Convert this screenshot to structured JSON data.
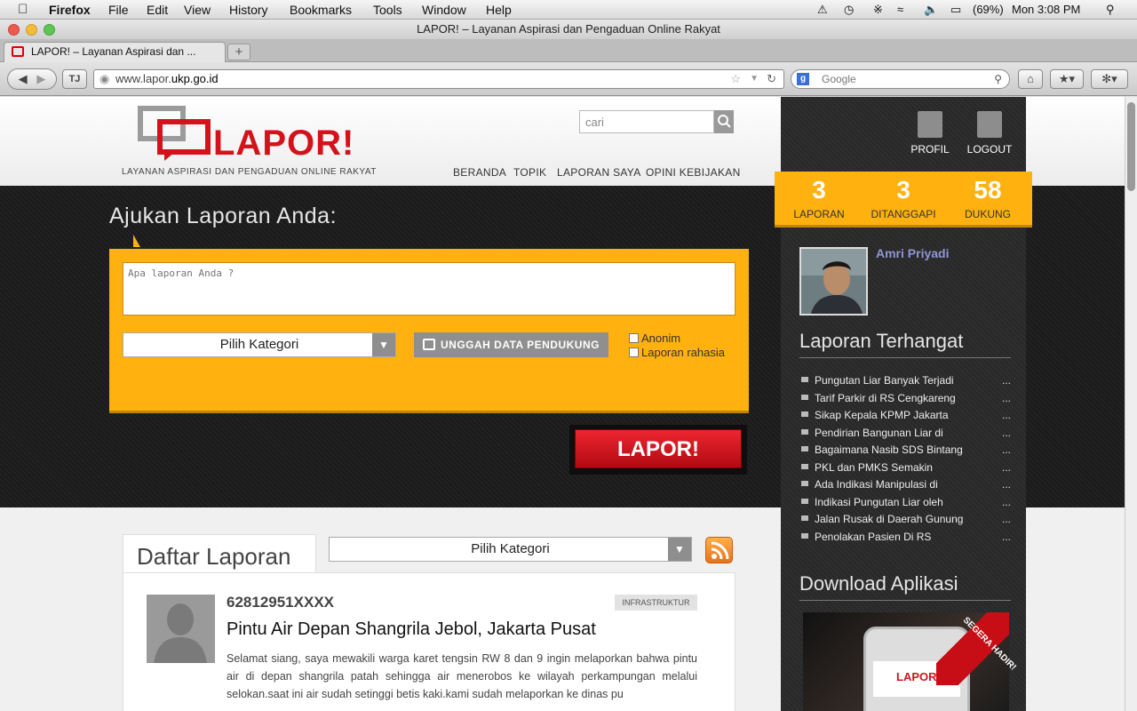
{
  "os_menu": {
    "app": "Firefox",
    "items": [
      "File",
      "Edit",
      "View",
      "History",
      "Bookmarks",
      "Tools",
      "Window",
      "Help"
    ],
    "battery": "(69%)",
    "clock": "Mon 3:08 PM"
  },
  "window": {
    "title": "LAPOR! – Layanan Aspirasi dan Pengaduan Online Rakyat"
  },
  "tab": {
    "label": "LAPOR! – Layanan Aspirasi dan ...",
    "new_tab": "+"
  },
  "navbar": {
    "url_prefix": "www.lapor.",
    "url_domain": "ukp.go.id",
    "search_placeholder": "Google"
  },
  "header": {
    "logo_text": "LAPOR!",
    "tagline": "LAYANAN ASPIRASI DAN PENGADUAN ONLINE RAKYAT",
    "search_placeholder": "cari",
    "nav": [
      "BERANDA",
      "TOPIK",
      "LAPORAN SAYA",
      "OPINI KEBIJAKAN"
    ]
  },
  "hero": {
    "title": "Ajukan Laporan Anda:",
    "report_placeholder": "Apa laporan Anda ?",
    "category_select": "Pilih Kategori",
    "upload_label": "UNGGAH DATA PENDUKUNG",
    "anon_label": "Anonim",
    "secret_label": "Laporan rahasia",
    "submit_label": "LAPOR!"
  },
  "list": {
    "tab_label": "Daftar Laporan",
    "category_select": "Pilih Kategori",
    "report": {
      "reporter": "62812951XXXX",
      "category": "INFRASTRUKTUR",
      "title": "Pintu Air Depan Shangrila Jebol, Jakarta Pusat",
      "body": "Selamat siang, saya mewakili warga karet tengsin RW 8 dan 9 ingin melaporkan bahwa pintu air di depan shangrila patah sehingga air menerobos ke wilayah perkampungan melalui selokan.saat ini air sudah setinggi betis kaki.kami sudah melaporkan ke dinas pu"
    }
  },
  "sidebar": {
    "profile_label": "PROFIL",
    "logout_label": "LOGOUT",
    "stats": [
      {
        "value": "3",
        "label": "LAPORAN"
      },
      {
        "value": "3",
        "label": "DITANGGAPI"
      },
      {
        "value": "58",
        "label": "DUKUNG"
      }
    ],
    "user_name": "Amri Priyadi",
    "hot_heading": "Laporan Terhangat",
    "hot_items": [
      "Pungutan Liar Banyak Terjadi",
      "Tarif Parkir di RS Cengkareng",
      "Sikap Kepala KPMP Jakarta",
      "Pendirian Bangunan Liar di",
      "Bagaimana Nasib SDS Bintang",
      "PKL dan PMKS Semakin",
      "Ada Indikasi Manipulasi di",
      "Indikasi Pungutan Liar oleh",
      "Jalan Rusak di Daerah Gunung",
      "Penolakan Pasien Di RS"
    ],
    "ellipsis": "...",
    "download_heading": "Download Aplikasi",
    "promo_ribbon": "SEGERA HADIR!",
    "promo_logo": "LAPOR!"
  },
  "colors": {
    "brand_red": "#d4121c",
    "accent_orange": "#ffb10f",
    "dark_bg": "#1d1d1d"
  }
}
